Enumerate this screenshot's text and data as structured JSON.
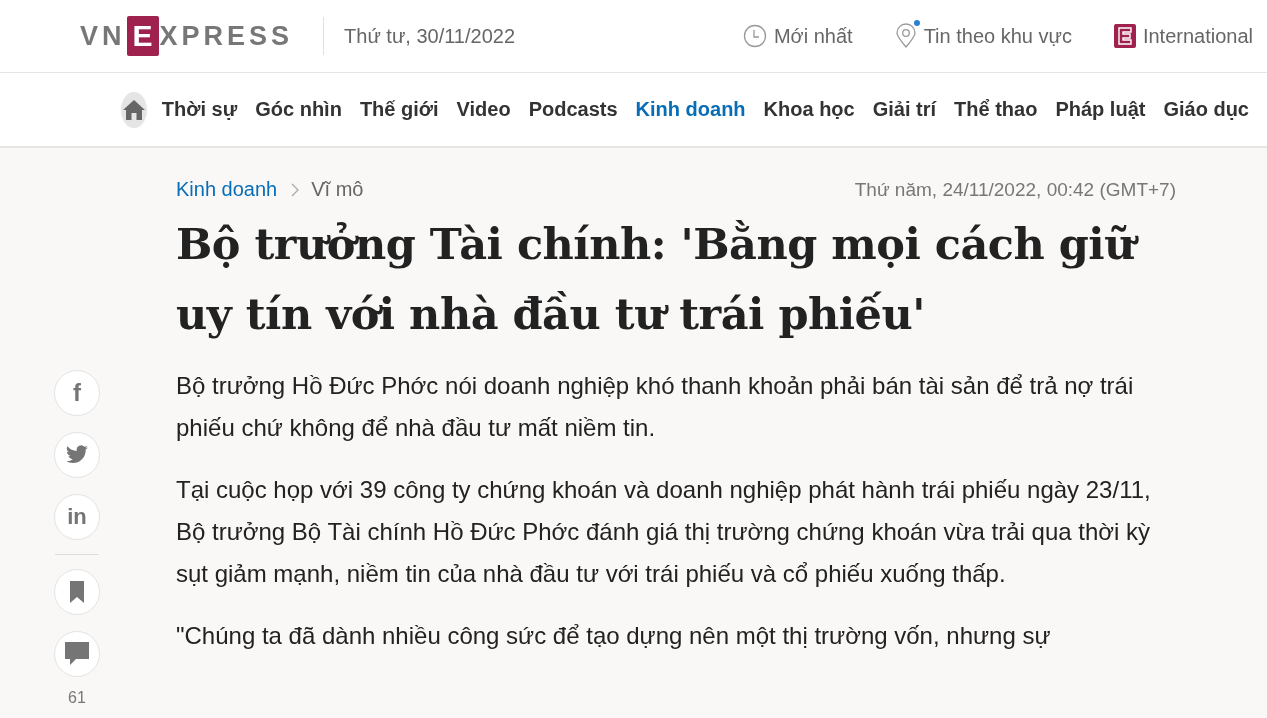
{
  "header": {
    "logo": {
      "left": "VN",
      "boxed": "E",
      "right": "XPRESS"
    },
    "date": "Thứ tư, 30/11/2022",
    "links": [
      {
        "kind": "clock",
        "label": "Mới nhất",
        "dot": false
      },
      {
        "kind": "pin",
        "label": "Tin theo khu vực",
        "dot": true
      },
      {
        "kind": "brand",
        "label": "International",
        "dot": false
      }
    ]
  },
  "nav": {
    "items": [
      {
        "label": "Thời sự",
        "selected": false
      },
      {
        "label": "Góc nhìn",
        "selected": false
      },
      {
        "label": "Thế giới",
        "selected": false
      },
      {
        "label": "Video",
        "selected": false
      },
      {
        "label": "Podcasts",
        "selected": false
      },
      {
        "label": "Kinh doanh",
        "selected": true
      },
      {
        "label": "Khoa học",
        "selected": false
      },
      {
        "label": "Giải trí",
        "selected": false
      },
      {
        "label": "Thể thao",
        "selected": false
      },
      {
        "label": "Pháp luật",
        "selected": false
      },
      {
        "label": "Giáo dục",
        "selected": false
      }
    ]
  },
  "share": {
    "buttons": [
      {
        "kind": "facebook",
        "text": "f"
      },
      {
        "kind": "twitter"
      },
      {
        "kind": "linkedin",
        "text": "in"
      },
      {
        "kind": "bookmark"
      },
      {
        "kind": "comment"
      }
    ],
    "comment_count": "61"
  },
  "article": {
    "breadcrumb": [
      "Kinh doanh",
      "Vĩ mô"
    ],
    "timestamp": "Thứ năm, 24/11/2022, 00:42 (GMT+7)",
    "title": "Bộ trưởng Tài chính: 'Bằng mọi cách giữ uy tín với nhà đầu tư trái phiếu'",
    "lead": "Bộ trưởng Hồ Đức Phớc nói doanh nghiệp khó thanh khoản phải bán tài sản để trả nợ trái phiếu chứ không để nhà đầu tư mất niềm tin.",
    "paragraphs": [
      "Tại cuộc họp với 39 công ty chứng khoán và doanh nghiệp phát hành trái phiếu ngày 23/11, Bộ trưởng Bộ Tài chính Hồ Đức Phớc đánh giá thị trường chứng khoán vừa trải qua thời kỳ sụt giảm mạnh, niềm tin của nhà đầu tư với trái phiếu và cổ phiếu xuống thấp.",
      "\"Chúng ta đã dành nhiều công sức để tạo dựng nên một thị trường vốn, nhưng sự"
    ]
  }
}
